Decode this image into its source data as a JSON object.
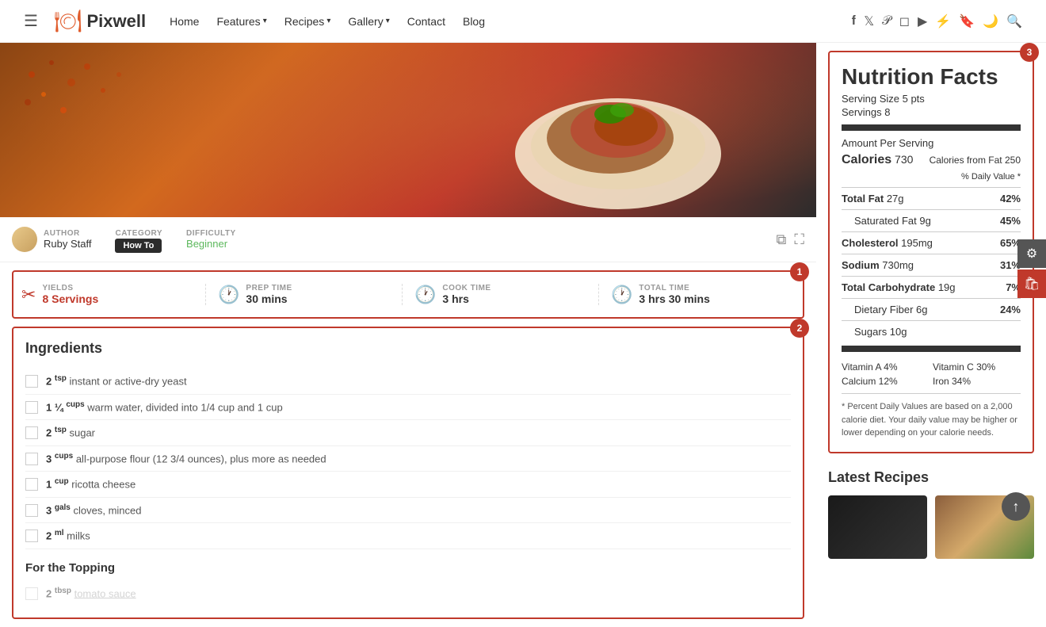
{
  "navbar": {
    "hamburger_icon": "☰",
    "logo_icon": "🍽",
    "logo_text": "Pixwell",
    "links": [
      {
        "label": "Home",
        "has_dropdown": false
      },
      {
        "label": "Features",
        "has_dropdown": true
      },
      {
        "label": "Recipes",
        "has_dropdown": true
      },
      {
        "label": "Gallery",
        "has_dropdown": true
      },
      {
        "label": "Contact",
        "has_dropdown": false
      },
      {
        "label": "Blog",
        "has_dropdown": false
      }
    ],
    "social_icons": [
      "f",
      "t",
      "p",
      "i",
      "yt",
      "⚡",
      "🔖",
      "🌙",
      "🔍"
    ]
  },
  "meta": {
    "author_label": "AUTHOR",
    "author_name": "Ruby Staff",
    "category_label": "CATEGORY",
    "category_value": "How To",
    "difficulty_label": "DIFFICULTY",
    "difficulty_value": "Beginner"
  },
  "recipe_stats": {
    "badge": "1",
    "yields_label": "YIELDS",
    "yields_value": "8 Servings",
    "prep_label": "PREP TIME",
    "prep_value": "30 mins",
    "cook_label": "COOK TIME",
    "cook_value": "3 hrs",
    "total_label": "TOTAL TIME",
    "total_value": "3 hrs 30 mins"
  },
  "ingredients": {
    "badge": "2",
    "title": "Ingredients",
    "items": [
      {
        "qty": "2",
        "unit": "tsp",
        "text": "instant or active-dry yeast"
      },
      {
        "qty": "1 ¼",
        "unit": "cups",
        "text": "warm water, divided into 1/4 cup and 1 cup"
      },
      {
        "qty": "2",
        "unit": "tsp",
        "text": "sugar"
      },
      {
        "qty": "3",
        "unit": "cups",
        "text": "all-purpose flour (12 3/4 ounces), plus more as needed"
      },
      {
        "qty": "1",
        "unit": "cup",
        "text": "ricotta cheese"
      },
      {
        "qty": "3",
        "unit": "gals",
        "text": "cloves, minced"
      },
      {
        "qty": "2",
        "unit": "ml",
        "text": "milks"
      }
    ],
    "topping_title": "For the Topping",
    "topping_items": [
      {
        "qty": "2",
        "unit": "tbsp",
        "text": "tomato sauce"
      }
    ]
  },
  "nutrition": {
    "badge": "3",
    "title": "Nutrition Facts",
    "serving_size_label": "Serving Size",
    "serving_size_value": "5 pts",
    "servings_label": "Servings",
    "servings_value": "8",
    "amount_per_serving": "Amount Per Serving",
    "calories_label": "Calories",
    "calories_value": "730",
    "calories_from_fat_label": "Calories from Fat",
    "calories_from_fat_value": "250",
    "daily_value_header": "% Daily Value *",
    "rows": [
      {
        "label": "Total Fat",
        "amount": "27g",
        "pct": "42%",
        "bold": true,
        "indent": false
      },
      {
        "label": "Saturated Fat",
        "amount": "9g",
        "pct": "45%",
        "bold": false,
        "indent": true
      },
      {
        "label": "Cholesterol",
        "amount": "195mg",
        "pct": "65%",
        "bold": true,
        "indent": false
      },
      {
        "label": "Sodium",
        "amount": "730mg",
        "pct": "31%",
        "bold": true,
        "indent": false
      },
      {
        "label": "Total Carbohydrate",
        "amount": "19g",
        "pct": "7%",
        "bold": true,
        "indent": false
      },
      {
        "label": "Dietary Fiber",
        "amount": "6g",
        "pct": "24%",
        "bold": false,
        "indent": true
      },
      {
        "label": "Sugars",
        "amount": "10g",
        "pct": "",
        "bold": false,
        "indent": true
      }
    ],
    "vitamins": [
      {
        "label": "Vitamin A 4%"
      },
      {
        "label": "Vitamin C 30%"
      },
      {
        "label": "Calcium 12%"
      },
      {
        "label": "Iron 34%"
      }
    ],
    "note": "* Percent Daily Values are based on a 2,000 calorie diet. Your daily value may be higher or lower depending on your calorie needs."
  },
  "latest_recipes": {
    "title": "Latest Recipes",
    "items": [
      {
        "color": "dark"
      },
      {
        "color": "warm"
      }
    ]
  },
  "floating": {
    "gear_icon": "⚙",
    "bag_icon": "🛍"
  },
  "scroll_top": {
    "icon": "↑"
  }
}
